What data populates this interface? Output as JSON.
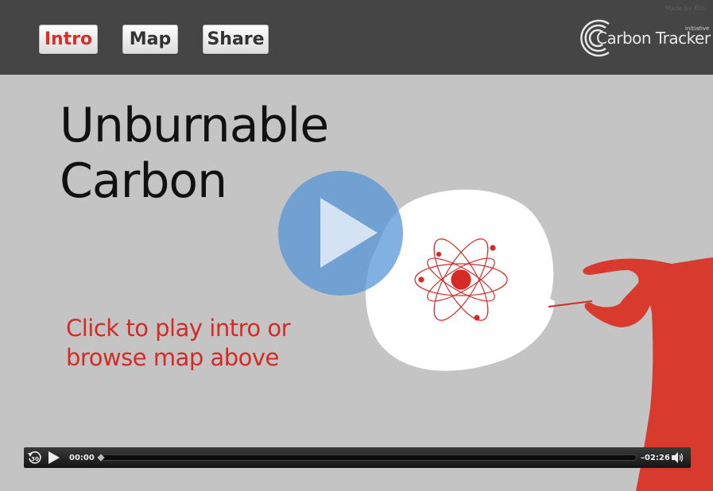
{
  "header": {
    "credit": "Made by Kiln",
    "nav": [
      {
        "label": "Intro",
        "active": true
      },
      {
        "label": "Map",
        "active": false
      },
      {
        "label": "Share",
        "active": false
      }
    ],
    "logo": {
      "text": "Carbon Tracker",
      "superscript": "initiative"
    }
  },
  "main": {
    "title_line1": "Unburnable",
    "title_line2": "Carbon",
    "cta_line1": "Click to play intro or",
    "cta_line2": "browse map above"
  },
  "player": {
    "current_time": "00:00",
    "remaining_time": "–02:26",
    "progress": 0.0,
    "rewind_label": "30"
  },
  "colors": {
    "accent_red": "#d42b26",
    "header_bg": "#454545",
    "stage_bg": "#c4c4c4",
    "play_blue": "#5091d7"
  },
  "icons": [
    "rewind-30-icon",
    "play-icon",
    "volume-icon",
    "atom-icon",
    "hand-icon"
  ]
}
